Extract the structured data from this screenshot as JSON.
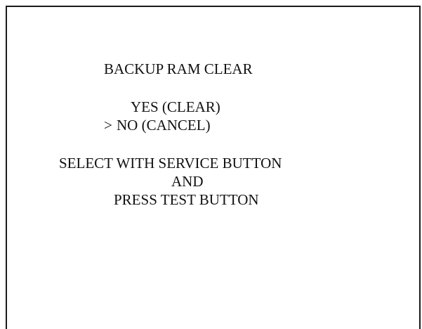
{
  "screen": {
    "title": "BACKUP RAM CLEAR",
    "options": [
      {
        "label": "YES (CLEAR)",
        "selected": false
      },
      {
        "label": "NO (CANCEL)",
        "selected": true
      }
    ],
    "cursor": ">",
    "instructions": [
      "SELECT WITH SERVICE BUTTON",
      "AND",
      "PRESS TEST BUTTON"
    ]
  },
  "colors": {
    "background": "#ffffff",
    "text": "#111111",
    "frame": "#1a1a1a"
  }
}
